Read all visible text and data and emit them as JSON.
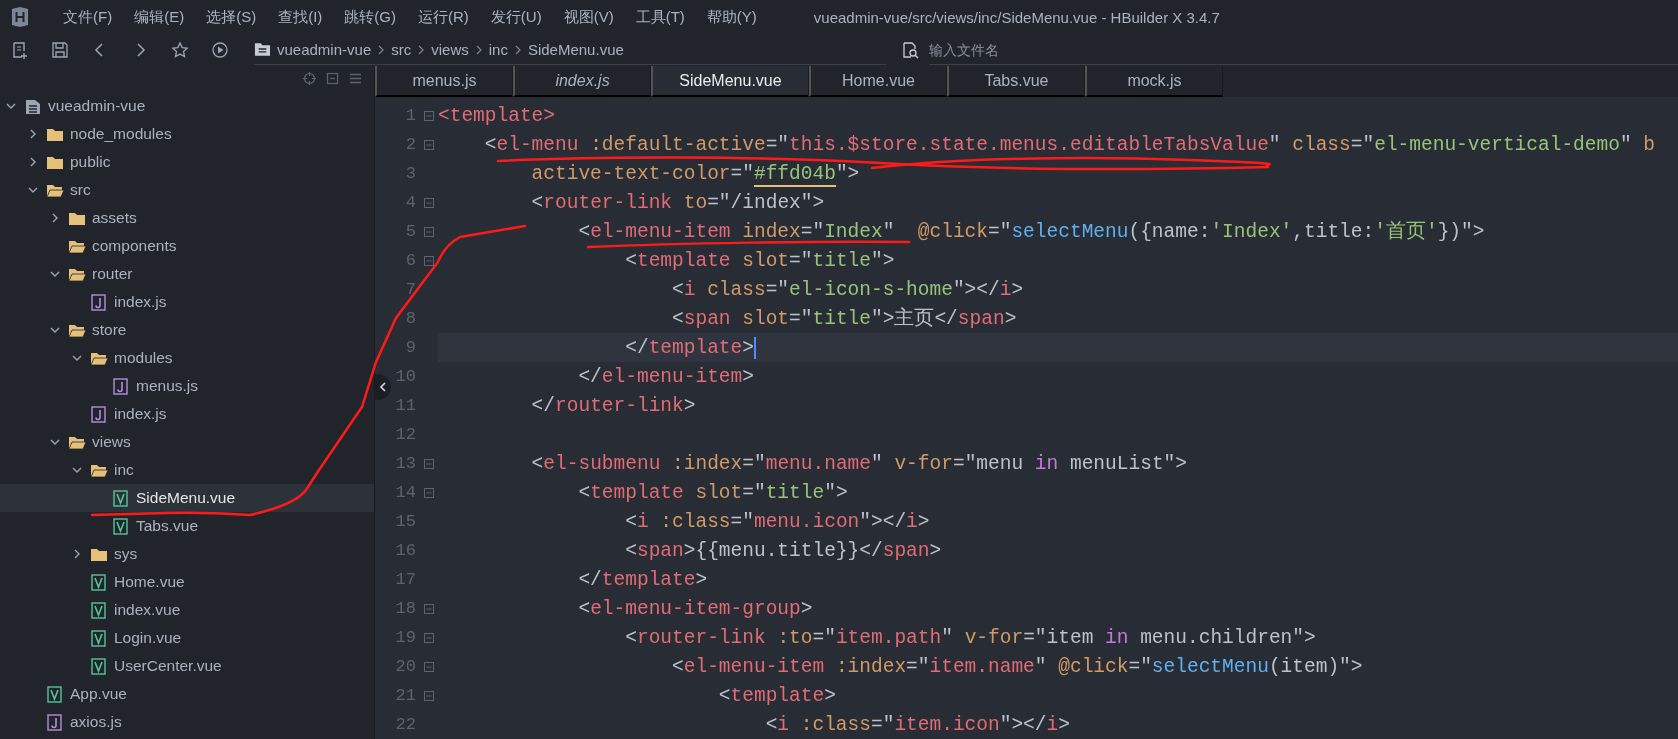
{
  "window": {
    "title": "vueadmin-vue/src/views/inc/SideMenu.vue - HBuilder X 3.4.7"
  },
  "menu_bar": [
    {
      "label": "文件(F)"
    },
    {
      "label": "编辑(E)"
    },
    {
      "label": "选择(S)"
    },
    {
      "label": "查找(I)"
    },
    {
      "label": "跳转(G)"
    },
    {
      "label": "运行(R)"
    },
    {
      "label": "发行(U)"
    },
    {
      "label": "视图(V)"
    },
    {
      "label": "工具(T)"
    },
    {
      "label": "帮助(Y)"
    }
  ],
  "breadcrumb": [
    "vueadmin-vue",
    "src",
    "views",
    "inc",
    "SideMenu.vue"
  ],
  "file_search": {
    "placeholder": "输入文件名"
  },
  "project_tree": [
    {
      "name": "vueadmin-vue",
      "kind": "project",
      "expanded": true,
      "selected": false,
      "children": [
        {
          "name": "node_modules",
          "kind": "folder",
          "expanded": false,
          "selected": false
        },
        {
          "name": "public",
          "kind": "folder",
          "expanded": false,
          "selected": false
        },
        {
          "name": "src",
          "kind": "folder",
          "expanded": true,
          "selected": false,
          "children": [
            {
              "name": "assets",
              "kind": "folder",
              "expanded": false,
              "selected": false
            },
            {
              "name": "components",
              "kind": "empty-folder",
              "selected": false
            },
            {
              "name": "router",
              "kind": "folder",
              "expanded": true,
              "selected": false,
              "children": [
                {
                  "name": "index.js",
                  "kind": "js",
                  "selected": false
                }
              ]
            },
            {
              "name": "store",
              "kind": "folder",
              "expanded": true,
              "selected": false,
              "children": [
                {
                  "name": "modules",
                  "kind": "folder",
                  "expanded": true,
                  "selected": false,
                  "children": [
                    {
                      "name": "menus.js",
                      "kind": "js",
                      "selected": false
                    }
                  ]
                },
                {
                  "name": "index.js",
                  "kind": "js",
                  "selected": false
                }
              ]
            },
            {
              "name": "views",
              "kind": "folder",
              "expanded": true,
              "selected": false,
              "children": [
                {
                  "name": "inc",
                  "kind": "folder",
                  "expanded": true,
                  "selected": false,
                  "children": [
                    {
                      "name": "SideMenu.vue",
                      "kind": "vue",
                      "selected": true
                    },
                    {
                      "name": "Tabs.vue",
                      "kind": "vue",
                      "selected": false
                    }
                  ]
                },
                {
                  "name": "sys",
                  "kind": "folder",
                  "expanded": false,
                  "selected": false
                },
                {
                  "name": "Home.vue",
                  "kind": "vue",
                  "selected": false
                },
                {
                  "name": "index.vue",
                  "kind": "vue",
                  "selected": false
                },
                {
                  "name": "Login.vue",
                  "kind": "vue",
                  "selected": false
                },
                {
                  "name": "UserCenter.vue",
                  "kind": "vue",
                  "selected": false
                }
              ]
            }
          ]
        },
        {
          "name": "App.vue",
          "kind": "vue",
          "selected": false
        },
        {
          "name": "axios.js",
          "kind": "js",
          "selected": false
        }
      ]
    }
  ],
  "tabs": [
    {
      "label": "menus.js",
      "selected": false,
      "preview": false
    },
    {
      "label": "index.js",
      "selected": false,
      "preview": true
    },
    {
      "label": "SideMenu.vue",
      "selected": true,
      "preview": false
    },
    {
      "label": "Home.vue",
      "selected": false,
      "preview": false
    },
    {
      "label": "Tabs.vue",
      "selected": false,
      "preview": false
    },
    {
      "label": "mock.js",
      "selected": false,
      "preview": false
    }
  ],
  "code_lines": [
    {
      "number": "1",
      "fold": true,
      "current": false,
      "tokens": [
        {
          "kind": "tag",
          "text": "<template>"
        }
      ]
    },
    {
      "number": "2",
      "fold": true,
      "current": false,
      "tokens": [
        {
          "kind": "plain",
          "text": "    <"
        },
        {
          "kind": "tag",
          "text": "el-menu "
        },
        {
          "kind": "attr",
          "text": ":default-active"
        },
        {
          "kind": "plain",
          "text": "=\""
        },
        {
          "kind": "expr",
          "text": "this.$store.state.menus.editableTabsValue"
        },
        {
          "kind": "plain",
          "text": "\" "
        },
        {
          "kind": "attr",
          "text": "class"
        },
        {
          "kind": "plain",
          "text": "=\""
        },
        {
          "kind": "str",
          "text": "el-menu-vertical-demo"
        },
        {
          "kind": "plain",
          "text": "\" "
        },
        {
          "kind": "attr",
          "text": "b"
        }
      ]
    },
    {
      "number": "3",
      "fold": false,
      "current": false,
      "tokens": [
        {
          "kind": "attr",
          "text": "        active-text-color"
        },
        {
          "kind": "plain",
          "text": "=\""
        },
        {
          "kind": "color",
          "text": "#ffd04b"
        },
        {
          "kind": "plain",
          "text": "\">"
        }
      ]
    },
    {
      "number": "4",
      "fold": true,
      "current": false,
      "tokens": [
        {
          "kind": "plain",
          "text": "        <"
        },
        {
          "kind": "tag",
          "text": "router-link "
        },
        {
          "kind": "attr",
          "text": "to"
        },
        {
          "kind": "plain",
          "text": "=\"/index\">"
        }
      ]
    },
    {
      "number": "5",
      "fold": true,
      "current": false,
      "tokens": [
        {
          "kind": "plain",
          "text": "            <"
        },
        {
          "kind": "tag",
          "text": "el-menu-item "
        },
        {
          "kind": "attr",
          "text": "index"
        },
        {
          "kind": "plain",
          "text": "=\""
        },
        {
          "kind": "str",
          "text": "Index"
        },
        {
          "kind": "plain",
          "text": "\"  "
        },
        {
          "kind": "attr",
          "text": "@click"
        },
        {
          "kind": "plain",
          "text": "=\""
        },
        {
          "kind": "fn",
          "text": "selectMenu"
        },
        {
          "kind": "plain",
          "text": "({name:"
        },
        {
          "kind": "str",
          "text": "'Index'"
        },
        {
          "kind": "plain",
          "text": ",title:"
        },
        {
          "kind": "str",
          "text": "'首页'"
        },
        {
          "kind": "plain",
          "text": "})\">"
        }
      ]
    },
    {
      "number": "6",
      "fold": true,
      "current": false,
      "tokens": [
        {
          "kind": "plain",
          "text": "                <"
        },
        {
          "kind": "tag",
          "text": "template "
        },
        {
          "kind": "attr",
          "text": "slot"
        },
        {
          "kind": "plain",
          "text": "=\""
        },
        {
          "kind": "str",
          "text": "title"
        },
        {
          "kind": "plain",
          "text": "\">"
        }
      ]
    },
    {
      "number": "7",
      "fold": false,
      "current": false,
      "tokens": [
        {
          "kind": "plain",
          "text": "                    <"
        },
        {
          "kind": "tag",
          "text": "i "
        },
        {
          "kind": "attr",
          "text": "class"
        },
        {
          "kind": "plain",
          "text": "=\""
        },
        {
          "kind": "str",
          "text": "el-icon-s-home"
        },
        {
          "kind": "plain",
          "text": "\"></"
        },
        {
          "kind": "tag",
          "text": "i"
        },
        {
          "kind": "plain",
          "text": ">"
        }
      ]
    },
    {
      "number": "8",
      "fold": false,
      "current": false,
      "tokens": [
        {
          "kind": "plain",
          "text": "                    <"
        },
        {
          "kind": "tag",
          "text": "span "
        },
        {
          "kind": "attr",
          "text": "slot"
        },
        {
          "kind": "plain",
          "text": "=\""
        },
        {
          "kind": "str",
          "text": "title"
        },
        {
          "kind": "plain",
          "text": "\">主页</"
        },
        {
          "kind": "tag",
          "text": "span"
        },
        {
          "kind": "plain",
          "text": ">"
        }
      ]
    },
    {
      "number": "9",
      "fold": false,
      "current": true,
      "tokens": [
        {
          "kind": "plain",
          "text": "                </"
        },
        {
          "kind": "tag",
          "text": "template"
        },
        {
          "kind": "plain",
          "text": ">"
        }
      ]
    },
    {
      "number": "10",
      "fold": false,
      "current": false,
      "tokens": [
        {
          "kind": "plain",
          "text": "            </"
        },
        {
          "kind": "tag",
          "text": "el-menu-item"
        },
        {
          "kind": "plain",
          "text": ">"
        }
      ]
    },
    {
      "number": "11",
      "fold": false,
      "current": false,
      "tokens": [
        {
          "kind": "plain",
          "text": "        </"
        },
        {
          "kind": "tag",
          "text": "router-link"
        },
        {
          "kind": "plain",
          "text": ">"
        }
      ]
    },
    {
      "number": "12",
      "fold": false,
      "current": false
    },
    {
      "number": "13",
      "fold": true,
      "current": false,
      "tokens": [
        {
          "kind": "plain",
          "text": "        <"
        },
        {
          "kind": "tag",
          "text": "el-submenu "
        },
        {
          "kind": "attr",
          "text": ":index"
        },
        {
          "kind": "plain",
          "text": "=\""
        },
        {
          "kind": "expr",
          "text": "menu.name"
        },
        {
          "kind": "plain",
          "text": "\" "
        },
        {
          "kind": "attr",
          "text": "v-for"
        },
        {
          "kind": "plain",
          "text": "=\"menu "
        },
        {
          "kind": "kw",
          "text": "in"
        },
        {
          "kind": "plain",
          "text": " menuList\">"
        }
      ]
    },
    {
      "number": "14",
      "fold": true,
      "current": false,
      "tokens": [
        {
          "kind": "plain",
          "text": "            <"
        },
        {
          "kind": "tag",
          "text": "template "
        },
        {
          "kind": "attr",
          "text": "slot"
        },
        {
          "kind": "plain",
          "text": "=\""
        },
        {
          "kind": "str",
          "text": "title"
        },
        {
          "kind": "plain",
          "text": "\">"
        }
      ]
    },
    {
      "number": "15",
      "fold": false,
      "current": false,
      "tokens": [
        {
          "kind": "plain",
          "text": "                <"
        },
        {
          "kind": "tag",
          "text": "i "
        },
        {
          "kind": "attr",
          "text": ":class"
        },
        {
          "kind": "plain",
          "text": "=\""
        },
        {
          "kind": "expr",
          "text": "menu.icon"
        },
        {
          "kind": "plain",
          "text": "\"></"
        },
        {
          "kind": "tag",
          "text": "i"
        },
        {
          "kind": "plain",
          "text": ">"
        }
      ]
    },
    {
      "number": "16",
      "fold": false,
      "current": false,
      "tokens": [
        {
          "kind": "plain",
          "text": "                <"
        },
        {
          "kind": "tag",
          "text": "span"
        },
        {
          "kind": "plain",
          "text": ">{{menu.title}}</"
        },
        {
          "kind": "tag",
          "text": "span"
        },
        {
          "kind": "plain",
          "text": ">"
        }
      ]
    },
    {
      "number": "17",
      "fold": false,
      "current": false,
      "tokens": [
        {
          "kind": "plain",
          "text": "            </"
        },
        {
          "kind": "tag",
          "text": "template"
        },
        {
          "kind": "plain",
          "text": ">"
        }
      ]
    },
    {
      "number": "18",
      "fold": true,
      "current": false,
      "tokens": [
        {
          "kind": "plain",
          "text": "            <"
        },
        {
          "kind": "tag",
          "text": "el-menu-item-group"
        },
        {
          "kind": "plain",
          "text": ">"
        }
      ]
    },
    {
      "number": "19",
      "fold": true,
      "current": false,
      "tokens": [
        {
          "kind": "plain",
          "text": "                <"
        },
        {
          "kind": "tag",
          "text": "router-link "
        },
        {
          "kind": "attr",
          "text": ":to"
        },
        {
          "kind": "plain",
          "text": "=\""
        },
        {
          "kind": "expr",
          "text": "item.path"
        },
        {
          "kind": "plain",
          "text": "\" "
        },
        {
          "kind": "attr",
          "text": "v-for"
        },
        {
          "kind": "plain",
          "text": "=\"item "
        },
        {
          "kind": "kw",
          "text": "in"
        },
        {
          "kind": "plain",
          "text": " menu.children\">"
        }
      ]
    },
    {
      "number": "20",
      "fold": true,
      "current": false,
      "tokens": [
        {
          "kind": "plain",
          "text": "                    <"
        },
        {
          "kind": "tag",
          "text": "el-menu-item "
        },
        {
          "kind": "attr",
          "text": ":index"
        },
        {
          "kind": "plain",
          "text": "=\""
        },
        {
          "kind": "expr",
          "text": "item.name"
        },
        {
          "kind": "plain",
          "text": "\" "
        },
        {
          "kind": "attr",
          "text": "@click"
        },
        {
          "kind": "plain",
          "text": "=\""
        },
        {
          "kind": "fn",
          "text": "selectMenu"
        },
        {
          "kind": "plain",
          "text": "(item)\">"
        }
      ]
    },
    {
      "number": "21",
      "fold": true,
      "current": false,
      "tokens": [
        {
          "kind": "plain",
          "text": "                        <"
        },
        {
          "kind": "tag",
          "text": "template"
        },
        {
          "kind": "plain",
          "text": ">"
        }
      ]
    },
    {
      "number": "22",
      "fold": false,
      "current": false,
      "tokens": [
        {
          "kind": "plain",
          "text": "                            <"
        },
        {
          "kind": "tag",
          "text": "i "
        },
        {
          "kind": "attr",
          "text": ":class"
        },
        {
          "kind": "plain",
          "text": "=\""
        },
        {
          "kind": "expr",
          "text": "item.icon"
        },
        {
          "kind": "plain",
          "text": "\"></"
        },
        {
          "kind": "tag",
          "text": "i"
        },
        {
          "kind": "plain",
          "text": ">"
        }
      ]
    }
  ]
}
